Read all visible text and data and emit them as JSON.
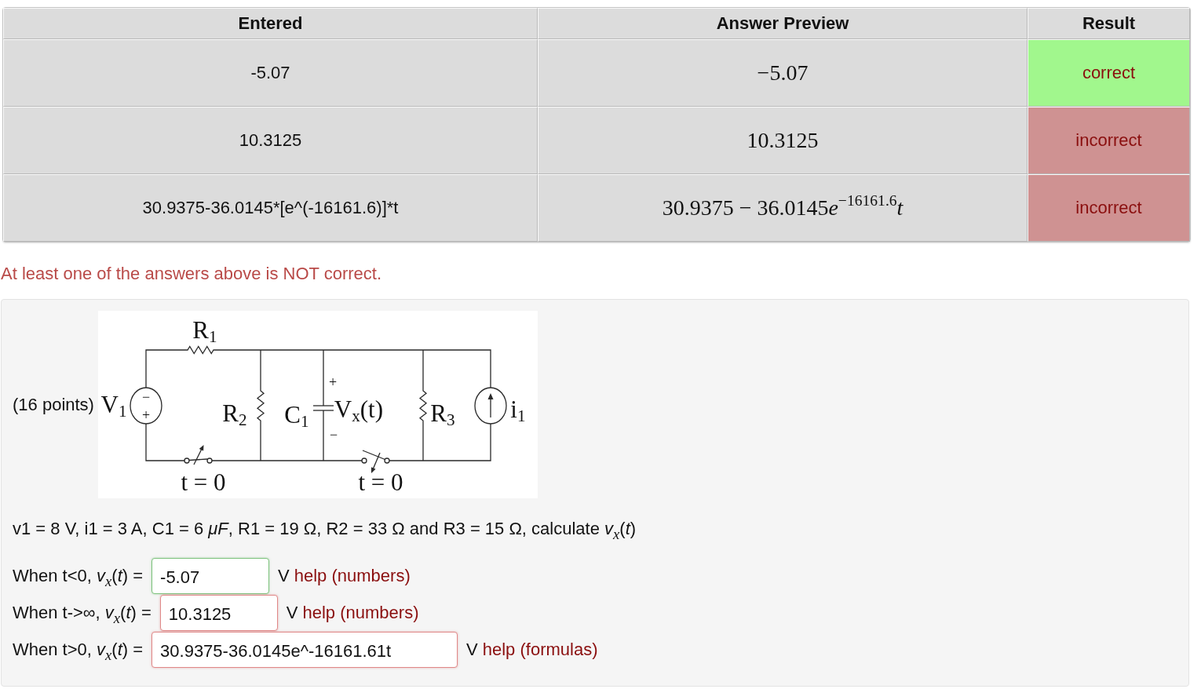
{
  "table": {
    "columns": [
      "Entered",
      "Answer Preview",
      "Result"
    ],
    "rows": [
      {
        "entered": "-5.07",
        "preview": [
          {
            "kind": "num",
            "text": "−5.07"
          }
        ],
        "result": "correct",
        "correct": true
      },
      {
        "entered": "10.3125",
        "preview": [
          {
            "kind": "num",
            "text": "10.3125"
          }
        ],
        "result": "incorrect",
        "correct": false
      },
      {
        "entered": "30.9375-36.0145*[e^(-16161.6)]*t",
        "preview": [
          {
            "kind": "num",
            "text": "30.9375 − 36.0145"
          },
          {
            "kind": "var",
            "text": "e"
          },
          {
            "kind": "sup",
            "text": "−16161.6"
          },
          {
            "kind": "var",
            "text": "t"
          }
        ],
        "result": "incorrect",
        "correct": false
      }
    ]
  },
  "message": "At least one of the answers above is NOT correct.",
  "problem": {
    "points": "(16 points)",
    "circuit": {
      "labels": [
        {
          "kind": "name",
          "text": "R$_{1}$"
        },
        {
          "kind": "name",
          "text": "V$_{1}$"
        },
        {
          "kind": "sign",
          "text": "−"
        },
        {
          "kind": "sign",
          "text": "+"
        },
        {
          "kind": "name",
          "text": "R$_{2}$"
        },
        {
          "kind": "name",
          "text": "C$_{1}$"
        },
        {
          "kind": "sign",
          "text": "+"
        },
        {
          "kind": "name",
          "text": "V$_{x}$(t)"
        },
        {
          "kind": "sign",
          "text": "−"
        },
        {
          "kind": "name",
          "text": "R$_{3}$"
        },
        {
          "kind": "name",
          "text": "i$_{1}$"
        },
        {
          "kind": "name",
          "text": "t = 0"
        },
        {
          "kind": "name",
          "text": "t = 0"
        }
      ]
    },
    "statement": "v1 = 8 V, i1 = 3 A, C1 = 6 *μF*, R1 = 19 Ω, R2 = 33 Ω and R3 = 15 Ω, calculate *v*$_{x}$(*t*)",
    "answers": [
      {
        "kind": "number",
        "label": "When t<0, *v*$_{x}$(*t*) =",
        "value": "-5.07",
        "correct": true,
        "unit": "V",
        "help": "help (numbers)"
      },
      {
        "kind": "number",
        "label": "When t->∞, *v*$_{x}$(*t*) =",
        "value": "10.3125",
        "correct": false,
        "unit": "V",
        "help": "help (numbers)"
      },
      {
        "kind": "formula",
        "label": "When t>0, *v*$_{x}$(*t*) =",
        "value": "30.9375-36.0145e^-16161.61t",
        "correct": false,
        "unit": "V",
        "help": "help (formulas)"
      }
    ]
  }
}
